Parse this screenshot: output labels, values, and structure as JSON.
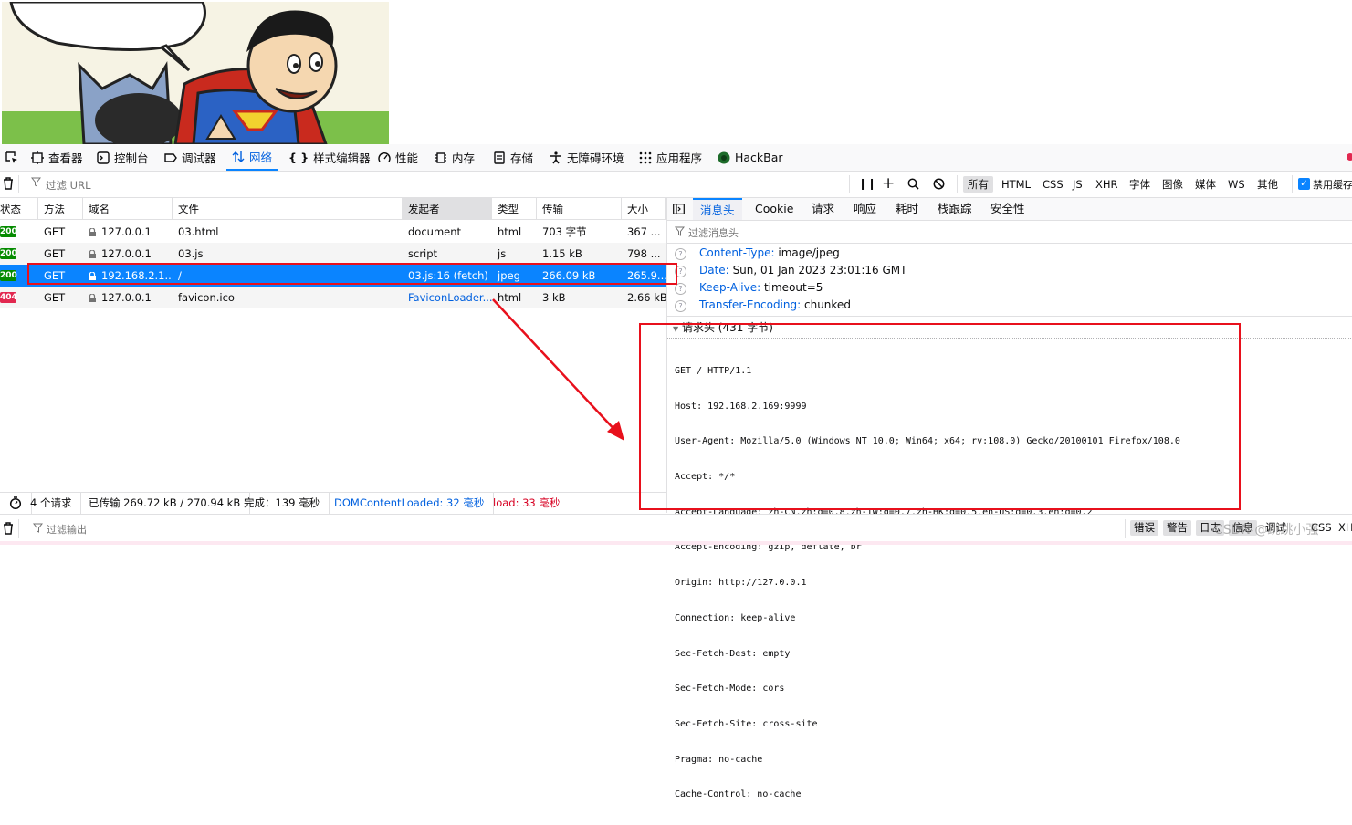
{
  "toolbar": {
    "tabs": [
      {
        "label": "查看器",
        "icon": "inspector-icon"
      },
      {
        "label": "控制台",
        "icon": "console-icon"
      },
      {
        "label": "调试器",
        "icon": "debugger-icon"
      },
      {
        "label": "网络",
        "icon": "network-icon",
        "active": true
      },
      {
        "label": "样式编辑器",
        "icon": "style-editor-icon"
      },
      {
        "label": "性能",
        "icon": "performance-icon"
      },
      {
        "label": "内存",
        "icon": "memory-icon"
      },
      {
        "label": "存储",
        "icon": "storage-icon"
      },
      {
        "label": "无障碍环境",
        "icon": "accessibility-icon"
      },
      {
        "label": "应用程序",
        "icon": "application-icon"
      },
      {
        "label": "HackBar",
        "icon": "hackbar-icon"
      }
    ]
  },
  "filter": {
    "placeholder": "过滤 URL",
    "types": [
      "所有",
      "HTML",
      "CSS",
      "JS",
      "XHR",
      "字体",
      "图像",
      "媒体",
      "WS",
      "其他"
    ],
    "selected_type": "所有",
    "disable_cache_label": "禁用缓存"
  },
  "table": {
    "columns": [
      "状态",
      "方法",
      "域名",
      "文件",
      "发起者",
      "类型",
      "传输",
      "大小"
    ],
    "rows": [
      {
        "status": "200",
        "method": "GET",
        "domain": "127.0.0.1",
        "file": "03.html",
        "initiator": "document",
        "type": "html",
        "transferred": "703 字节",
        "size": "367 ..."
      },
      {
        "status": "200",
        "method": "GET",
        "domain": "127.0.0.1",
        "file": "03.js",
        "initiator": "script",
        "type": "js",
        "transferred": "1.15 kB",
        "size": "798 ..."
      },
      {
        "status": "200",
        "method": "GET",
        "domain": "192.168.2.1...",
        "file": "/",
        "initiator": "03.js:16 (fetch)",
        "type": "jpeg",
        "transferred": "266.09 kB",
        "size": "265.9...",
        "selected": true
      },
      {
        "status": "404",
        "method": "GET",
        "domain": "127.0.0.1",
        "file": "favicon.ico",
        "initiator": "FaviconLoader....",
        "type": "html",
        "transferred": "3 kB",
        "size": "2.66 kB"
      }
    ]
  },
  "statusbar": {
    "requests": "4 个请求",
    "transferred": "已传输 269.72 kB / 270.94 kB",
    "finish": "完成：139 毫秒",
    "dcl": "DOMContentLoaded: 32 毫秒",
    "load": "load: 33 毫秒"
  },
  "panel": {
    "tabs": [
      "消息头",
      "Cookie",
      "请求",
      "响应",
      "耗时",
      "栈跟踪",
      "安全性"
    ],
    "active_tab": "消息头",
    "filter_placeholder": "过滤消息头",
    "response_headers": [
      {
        "name": "Content-Type:",
        "value": "image/jpeg"
      },
      {
        "name": "Date:",
        "value": "Sun, 01 Jan 2023 23:01:16 GMT"
      },
      {
        "name": "Keep-Alive:",
        "value": "timeout=5"
      },
      {
        "name": "Transfer-Encoding:",
        "value": "chunked"
      }
    ],
    "request_headers_title": "请求头 (431 字节)",
    "raw_request": [
      "GET / HTTP/1.1",
      "Host: 192.168.2.169:9999",
      "User-Agent: Mozilla/5.0 (Windows NT 10.0; Win64; x64; rv:108.0) Gecko/20100101 Firefox/108.0",
      "Accept: */*",
      "Accept-Language: zh-CN,zh;q=0.8,zh-TW;q=0.7,zh-HK;q=0.5,en-US;q=0.3,en;q=0.2",
      "Accept-Encoding: gzip, deflate, br",
      "Origin: http://127.0.0.1",
      "Connection: keep-alive",
      "Sec-Fetch-Dest: empty",
      "Sec-Fetch-Mode: cors",
      "Sec-Fetch-Site: cross-site",
      "Pragma: no-cache",
      "Cache-Control: no-cache"
    ]
  },
  "console": {
    "filter_placeholder": "过滤输出",
    "buttons": [
      "错误",
      "警告",
      "日志",
      "信息",
      "调试",
      "CSS",
      "XH"
    ]
  },
  "watermark": "CSDN @跳跳小强",
  "colors": {
    "accent": "#0a84ff",
    "status_ok": "#058b00",
    "status_404": "#e22850",
    "annotation": "#e8101c"
  }
}
